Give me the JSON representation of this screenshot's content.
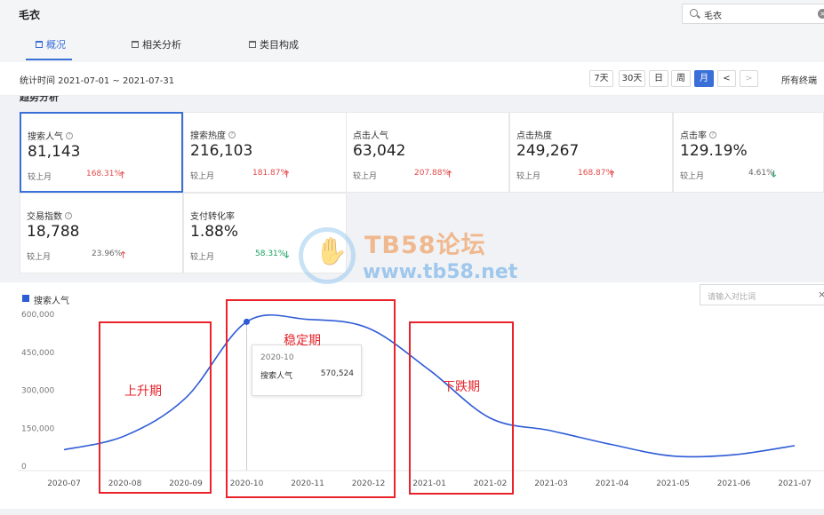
{
  "header": {
    "title": "毛衣",
    "search_value": "毛衣",
    "tabs": [
      {
        "label": "概况",
        "active": true
      },
      {
        "label": "相关分析",
        "active": false
      },
      {
        "label": "类目构成",
        "active": false
      }
    ]
  },
  "date_bar": {
    "range_text": "统计时间 2021-07-01 ~ 2021-07-31",
    "buttons": [
      "7天",
      "30天",
      "日",
      "周",
      "月"
    ],
    "active_button": "月",
    "prev": "<",
    "next": ">",
    "terminal": "所有终端"
  },
  "section_title": "趋势分析",
  "metrics": [
    {
      "label": "搜索人气",
      "value": "81,143",
      "compare": "较上月",
      "pct": "168.31%",
      "dir": "up"
    },
    {
      "label": "搜索热度",
      "value": "216,103",
      "compare": "较上月",
      "pct": "181.87%",
      "dir": "up"
    },
    {
      "label": "点击人气",
      "value": "63,042",
      "compare": "较上月",
      "pct": "207.88%",
      "dir": "up"
    },
    {
      "label": "点击热度",
      "value": "249,267",
      "compare": "较上月",
      "pct": "168.87%",
      "dir": "up"
    },
    {
      "label": "点击率",
      "value": "129.19%",
      "compare": "较上月",
      "pct": "4.61%",
      "dir": "down"
    },
    {
      "label": "交易指数",
      "value": "18,788",
      "compare": "较上月",
      "pct": "23.96%",
      "dir": "up"
    },
    {
      "label": "支付转化率",
      "value": "1.88%",
      "compare": "较上月",
      "pct": "58.31%",
      "dir": "down"
    }
  ],
  "chart": {
    "legend": "搜索人气",
    "compare_placeholder": "请输入对比词",
    "compare_clear": "×",
    "tooltip": {
      "title": "2020-10",
      "name": "搜索人气",
      "value": "570,524"
    },
    "annotations": [
      "上升期",
      "稳定期",
      "下跌期"
    ]
  },
  "watermark": {
    "title": "TB58论坛",
    "url": "www.tb58.net"
  },
  "colors": {
    "accent": "#3a6fd8",
    "line": "#2e5bd6",
    "up": "#e24a4a",
    "down": "#1aa15d",
    "annotation": "#e8232a"
  },
  "chart_data": {
    "type": "line",
    "x": [
      "2020-07",
      "2020-08",
      "2020-09",
      "2020-10",
      "2020-11",
      "2020-12",
      "2021-01",
      "2021-02",
      "2021-03",
      "2021-04",
      "2021-05",
      "2021-06",
      "2021-07"
    ],
    "series": [
      {
        "name": "搜索人气",
        "values": [
          65000,
          120000,
          270000,
          570524,
          580000,
          545000,
          380000,
          190000,
          140000,
          85000,
          40000,
          45000,
          81143
        ]
      }
    ],
    "yticks": [
      "0",
      "150,000",
      "300,000",
      "450,000",
      "600,000"
    ],
    "ylim": [
      0,
      600000
    ],
    "highlight_index": 3
  }
}
